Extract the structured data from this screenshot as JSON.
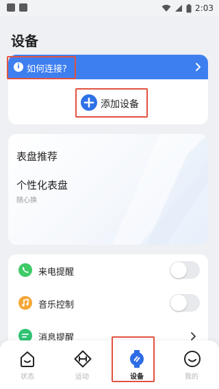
{
  "status_bar": {
    "time": "2:03"
  },
  "page": {
    "title": "设备"
  },
  "connect": {
    "label": "如何连接?"
  },
  "add_device": {
    "label": "添加设备"
  },
  "dial": {
    "title": "表盘推荐",
    "subtitle": "个性化表盘",
    "note": "随心换"
  },
  "settings": {
    "items": [
      {
        "label": "来电提醒",
        "icon": "phone-icon",
        "type": "toggle",
        "on": false
      },
      {
        "label": "音乐控制",
        "icon": "music-icon",
        "type": "toggle",
        "on": false
      },
      {
        "label": "消息提醒",
        "icon": "message-icon",
        "type": "link"
      }
    ]
  },
  "tabs": [
    {
      "label": "状态",
      "icon": "status-icon",
      "active": false
    },
    {
      "label": "运动",
      "icon": "sport-icon",
      "active": false
    },
    {
      "label": "设备",
      "icon": "device-icon",
      "active": true
    },
    {
      "label": "我的",
      "icon": "profile-icon",
      "active": false
    }
  ],
  "colors": {
    "accent": "#3e7ff0",
    "highlight": "#e2513f",
    "phone": "#3ecb68",
    "music": "#f4a838",
    "message": "#2fc373"
  }
}
